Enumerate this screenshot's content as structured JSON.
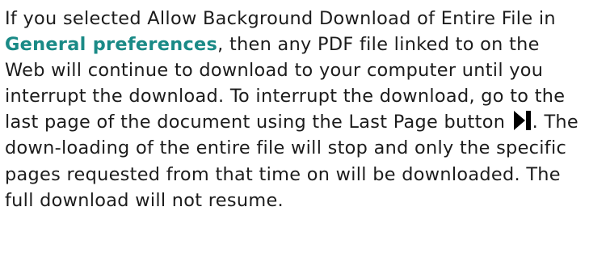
{
  "help": {
    "segment_1": "If you selected Allow Background Download of Entire File in ",
    "link_general_preferences": "General preferences",
    "segment_2": ", then any PDF file linked to on the Web will continue to download to your computer until you interrupt the download. To interrupt the download, go to the last page of the document using the Last Page button ",
    "last_page_icon": "last-page-icon",
    "segment_3": ". The down-​loading of the entire file will stop and only the specific pages requested from that time on will be downloaded. The full download will not resume.",
    "colors": {
      "link": "#1a8a86",
      "text": "#1c1c1c"
    }
  }
}
